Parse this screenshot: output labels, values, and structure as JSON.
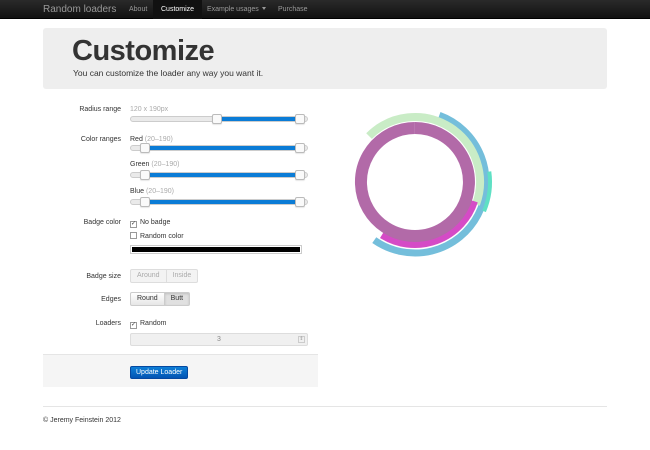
{
  "navbar": {
    "brand": "Random loaders",
    "items": [
      {
        "label": "About",
        "active": false
      },
      {
        "label": "Customize",
        "active": true
      },
      {
        "label": "Example usages",
        "active": false,
        "dropdown": true
      },
      {
        "label": "Purchase",
        "active": false
      }
    ]
  },
  "hero": {
    "title": "Customize",
    "subtitle": "You can customize the loader any way you want it."
  },
  "form": {
    "radius_range": {
      "label": "Radius range",
      "value_text": "120 x 190px",
      "min_fraction": 0.49,
      "max_fraction": 0.96
    },
    "color_ranges": {
      "label": "Color ranges",
      "channels": [
        {
          "name": "Red",
          "range": "(20–190)",
          "min_fraction": 0.08,
          "max_fraction": 0.96
        },
        {
          "name": "Green",
          "range": "(20–190)",
          "min_fraction": 0.08,
          "max_fraction": 0.96
        },
        {
          "name": "Blue",
          "range": "(20–190)",
          "min_fraction": 0.08,
          "max_fraction": 0.96
        }
      ]
    },
    "badge_color": {
      "label": "Badge color",
      "no_badge": {
        "label": "No badge",
        "checked": true
      },
      "random_color": {
        "label": "Random color",
        "checked": false
      },
      "color": "#000000"
    },
    "badge_size": {
      "label": "Badge size",
      "options": [
        "Around",
        "Inside"
      ]
    },
    "edges": {
      "label": "Edges",
      "options": [
        "Round",
        "Butt"
      ],
      "selected": "Butt"
    },
    "loaders": {
      "label": "Loaders",
      "random": {
        "label": "Random",
        "checked": true
      },
      "count": "3"
    },
    "submit_label": "Update Loader"
  },
  "footer": {
    "text": "© Jeremy Feinstein 2012"
  },
  "colors": {
    "slider_fill": "#0b7cd6",
    "ring_blue": "#74bedb",
    "ring_green": "#c9ecc6",
    "ring_purple": "#b26aa8",
    "ring_magenta": "#d54bc6",
    "ring_teal": "#5fe0c4"
  }
}
